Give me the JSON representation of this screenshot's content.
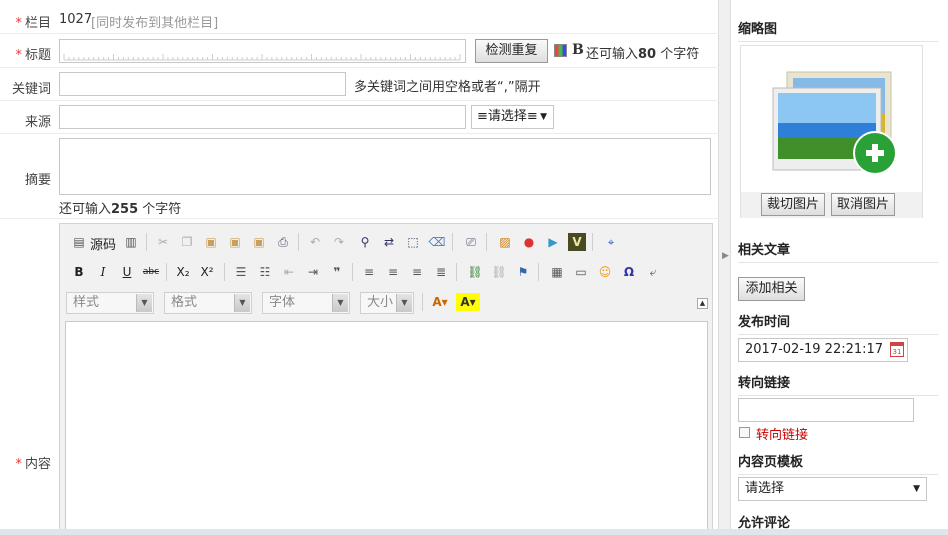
{
  "form": {
    "column": {
      "label": "栏目",
      "id": "1027",
      "hint": "[同时发布到其他栏目]"
    },
    "title": {
      "label": "标题",
      "value": "",
      "check_button": "检测重复",
      "remain_prefix": "还可输入",
      "remain_count": "80",
      "remain_suffix": "个字符"
    },
    "keywords": {
      "label": "关键词",
      "value": "",
      "hint": "多关键词之间用空格或者“,”隔开"
    },
    "source": {
      "label": "来源",
      "value": "",
      "select": "≡请选择≡"
    },
    "summary": {
      "label": "摘要",
      "value": "",
      "remain_prefix": "还可输入",
      "remain_count": "255",
      "remain_suffix": "个字符"
    },
    "content": {
      "label": "内容"
    },
    "required_mark": "*"
  },
  "editor": {
    "source_label": "源码",
    "combos": {
      "style": "样式",
      "format": "格式",
      "font": "字体",
      "size": "大小"
    },
    "text_buttons": {
      "bold": "B",
      "italic": "I",
      "underline": "U",
      "strike": "abc",
      "subscript": "X₂",
      "superscript": "X²",
      "quote": "❞",
      "omega": "Ω"
    }
  },
  "side": {
    "thumbnail": {
      "title": "缩略图",
      "crop_button": "裁切图片",
      "cancel_button": "取消图片"
    },
    "related": {
      "title": "相关文章",
      "add_button": "添加相关"
    },
    "publish": {
      "title": "发布时间",
      "value": "2017-02-19 22:21:17"
    },
    "redirect": {
      "title": "转向链接",
      "checkbox_label": "转向链接",
      "value": ""
    },
    "template": {
      "title": "内容页模板",
      "select": "请选择"
    },
    "comments": {
      "title": "允许评论"
    }
  }
}
